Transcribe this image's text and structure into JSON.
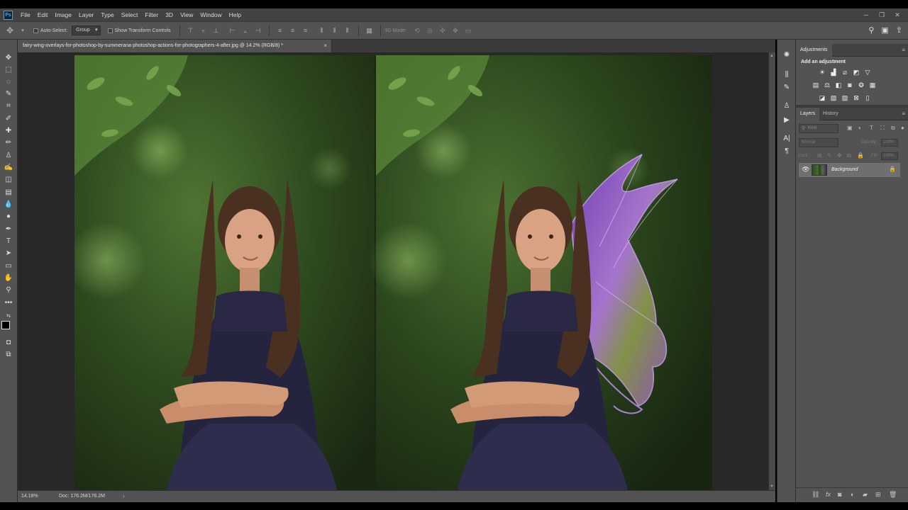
{
  "menubar": {
    "app_logo": "Ps",
    "items": [
      "File",
      "Edit",
      "Image",
      "Layer",
      "Type",
      "Select",
      "Filter",
      "3D",
      "View",
      "Window",
      "Help"
    ],
    "window_controls": [
      "─",
      "❐",
      "✕"
    ]
  },
  "options": {
    "auto_select_label": "Auto-Select:",
    "auto_select_value": "Group",
    "show_transform_label": "Show Transform Controls",
    "mode_3d_label": "3D Mode:"
  },
  "document": {
    "tab_title": "fairy-wing-overlays-for-photoshop-by-summerana-photoshop-actions-for-photographers-4-after.jpg @ 14.2% (RGB/8) *",
    "tab_close": "×"
  },
  "status": {
    "zoom": "14.18%",
    "doc_size": "Doc: 176.2M/176.2M",
    "arrow": "›"
  },
  "panels": {
    "adjustments_tab": "Adjustments",
    "add_adjustment": "Add an adjustment",
    "layers_tab": "Layers",
    "history_tab": "History",
    "kind_label": "Kind",
    "blend_mode": "Normal",
    "opacity_label": "Opacity:",
    "opacity_value": "100%",
    "lock_label": "Lock:",
    "fill_label": "Fill:",
    "fill_value": "100%"
  },
  "layers": [
    {
      "name": "Background",
      "visible": true,
      "locked": true
    }
  ],
  "colors": {
    "accent": "#3fa8f4",
    "wing": "#9b4fd1"
  }
}
